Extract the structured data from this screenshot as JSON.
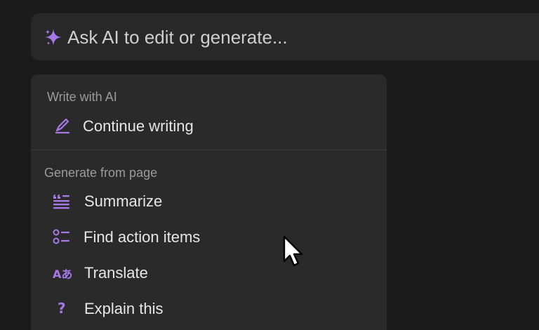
{
  "ai_bar": {
    "placeholder": "Ask AI to edit or generate...",
    "icon": "sparkle-icon",
    "accent_color": "#a678e8"
  },
  "menu": {
    "sections": [
      {
        "title": "Write with AI",
        "items": [
          {
            "label": "Continue writing",
            "icon": "pen-icon"
          }
        ]
      },
      {
        "title": "Generate from page",
        "items": [
          {
            "label": "Summarize",
            "icon": "summarize-icon"
          },
          {
            "label": "Find action items",
            "icon": "checklist-icon"
          },
          {
            "label": "Translate",
            "icon": "translate-icon",
            "glyph": "Aあ"
          },
          {
            "label": "Explain this",
            "icon": "question-icon",
            "glyph": "?"
          }
        ]
      }
    ]
  },
  "colors": {
    "background": "#1b1b1b",
    "panel": "#2a2a2a",
    "accent": "#a678e8",
    "muted_text": "#9b9b9b",
    "text": "#e6e6e6"
  }
}
